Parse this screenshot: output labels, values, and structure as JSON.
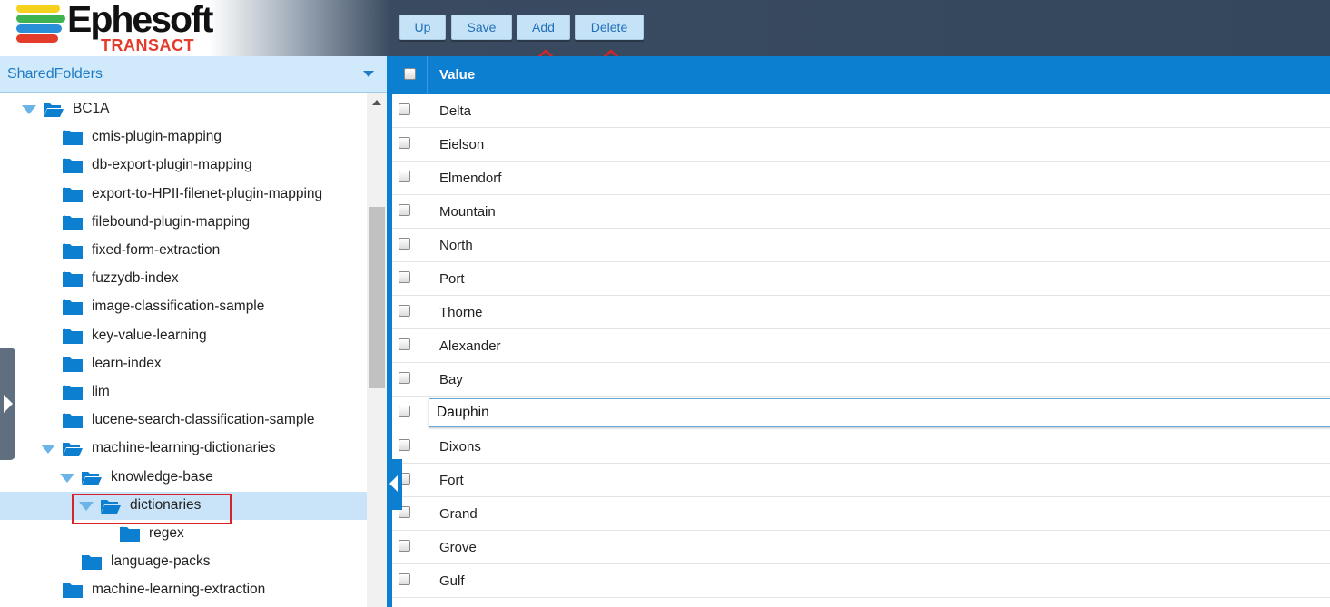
{
  "brand": {
    "name": "Ephesoft",
    "product": "TRANSACT",
    "stripe_colors": [
      "#f5d21e",
      "#3fb34f",
      "#2b8fd8",
      "#e33c2b"
    ]
  },
  "toolbar": {
    "up_label": "Up",
    "save_label": "Save",
    "add_label": "Add",
    "delete_label": "Delete"
  },
  "folder_selector": {
    "value": "SharedFolders"
  },
  "tree": {
    "items": [
      {
        "label": "BC1A",
        "state": "expanded"
      },
      {
        "label": "cmis-plugin-mapping",
        "state": "collapsed"
      },
      {
        "label": "db-export-plugin-mapping",
        "state": "collapsed"
      },
      {
        "label": "export-to-HPII-filenet-plugin-mapping",
        "state": "collapsed"
      },
      {
        "label": "filebound-plugin-mapping",
        "state": "collapsed"
      },
      {
        "label": "fixed-form-extraction",
        "state": "collapsed"
      },
      {
        "label": "fuzzydb-index",
        "state": "collapsed"
      },
      {
        "label": "image-classification-sample",
        "state": "collapsed"
      },
      {
        "label": "key-value-learning",
        "state": "collapsed"
      },
      {
        "label": "learn-index",
        "state": "collapsed"
      },
      {
        "label": "lim",
        "state": "collapsed"
      },
      {
        "label": "lucene-search-classification-sample",
        "state": "collapsed"
      },
      {
        "label": "machine-learning-dictionaries",
        "state": "expanded"
      },
      {
        "label": "knowledge-base",
        "state": "expanded"
      },
      {
        "label": "dictionaries",
        "state": "expanded",
        "selected": true
      },
      {
        "label": "regex",
        "state": "collapsed"
      },
      {
        "label": "language-packs",
        "state": "collapsed"
      },
      {
        "label": "machine-learning-extraction",
        "state": "collapsed"
      }
    ]
  },
  "grid": {
    "column_header": "Value",
    "rows": [
      {
        "value": "Delta"
      },
      {
        "value": "Eielson"
      },
      {
        "value": "Elmendorf"
      },
      {
        "value": "Mountain"
      },
      {
        "value": "North"
      },
      {
        "value": "Port"
      },
      {
        "value": "Thorne"
      },
      {
        "value": "Alexander"
      },
      {
        "value": "Bay"
      },
      {
        "value": "Dauphin",
        "editing": true
      },
      {
        "value": "Dixons"
      },
      {
        "value": "Fort"
      },
      {
        "value": "Grand"
      },
      {
        "value": "Grove"
      },
      {
        "value": "Gulf"
      }
    ]
  },
  "colors": {
    "accent": "#0c7fd1",
    "header_dark": "#34475d",
    "annotation_red": "#d8232a",
    "selected_row": "#c9e4f8"
  }
}
